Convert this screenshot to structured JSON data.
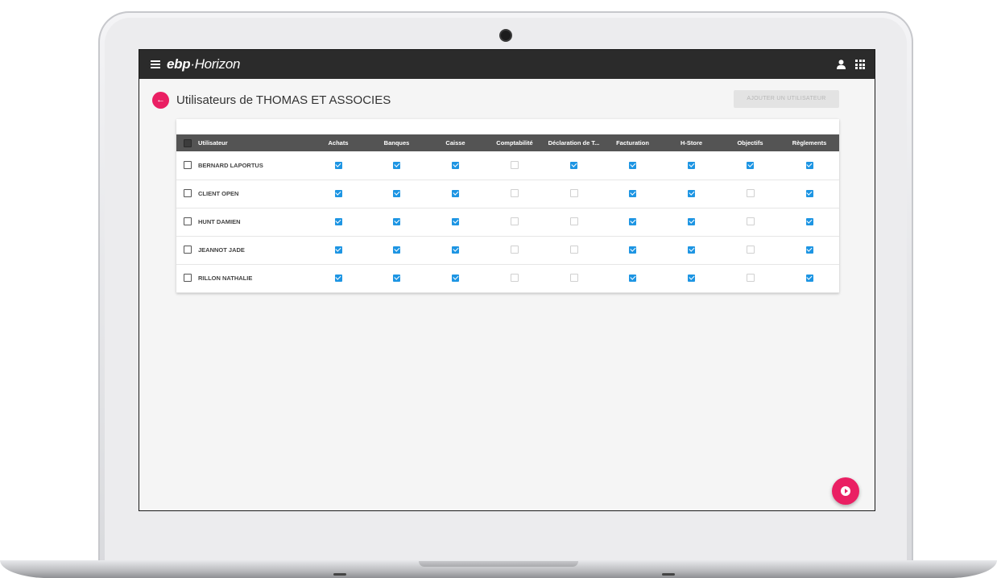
{
  "app": {
    "logo_bold": "ebp",
    "logo_rest": "·Horizon"
  },
  "header": {
    "title": "Utilisateurs de THOMAS ET ASSOCIES",
    "add_button": "AJOUTER UN UTILISATEUR"
  },
  "table": {
    "columns": [
      "Utilisateur",
      "Achats",
      "Banques",
      "Caisse",
      "Comptabilité",
      "Déclaration de T...",
      "Facturation",
      "H-Store",
      "Objectifs",
      "Règlements"
    ],
    "rows": [
      {
        "name": "BERNARD LAPORTUS",
        "perms": [
          true,
          true,
          true,
          false,
          true,
          true,
          true,
          true,
          true
        ]
      },
      {
        "name": "CLIENT OPEN",
        "perms": [
          true,
          true,
          true,
          false,
          false,
          true,
          true,
          false,
          true
        ]
      },
      {
        "name": "HUNT DAMIEN",
        "perms": [
          true,
          true,
          true,
          false,
          false,
          true,
          true,
          false,
          true
        ]
      },
      {
        "name": "JEANNOT JADE",
        "perms": [
          true,
          true,
          true,
          false,
          false,
          true,
          true,
          false,
          true
        ]
      },
      {
        "name": "RILLON NATHALIE",
        "perms": [
          true,
          true,
          true,
          false,
          false,
          true,
          true,
          false,
          true
        ]
      }
    ]
  },
  "icons": {
    "menu": "menu-icon",
    "user": "user-icon",
    "apps": "apps-grid-icon",
    "back": "back-arrow-icon",
    "fab": "play-circle-icon"
  },
  "colors": {
    "accent": "#ea1f63",
    "checkbox_on": "#1d95e3",
    "topbar": "#2b2b2b",
    "table_header": "#545454"
  }
}
